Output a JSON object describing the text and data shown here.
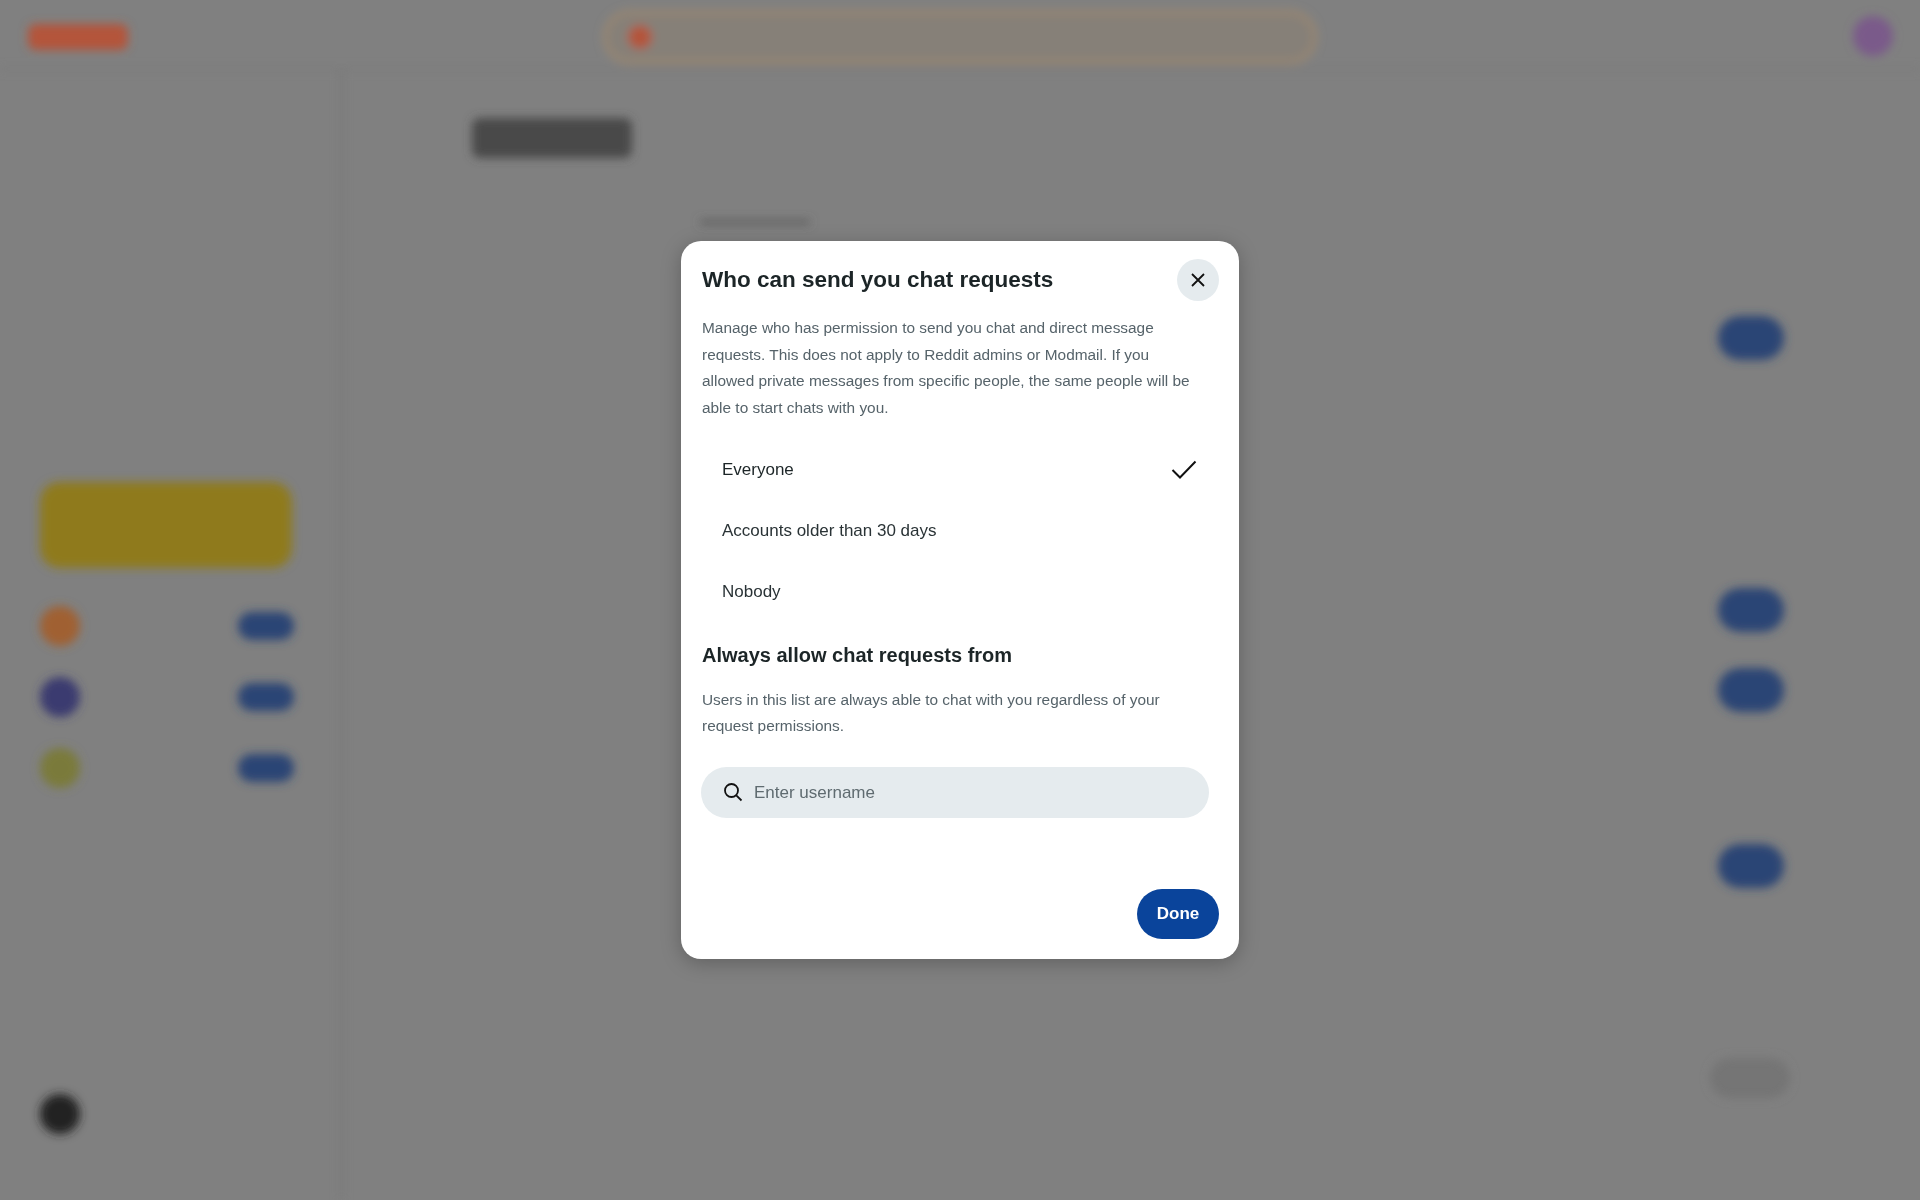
{
  "dialog": {
    "title": "Who can send you chat requests",
    "description": "Manage who has permission to send you chat and direct message requests. This does not apply to Reddit admins or Modmail. If you allowed private messages from specific people, the same people will be able to start chats with you.",
    "options": [
      {
        "label": "Everyone",
        "selected": true
      },
      {
        "label": "Accounts older than 30 days",
        "selected": false
      },
      {
        "label": "Nobody",
        "selected": false
      }
    ],
    "allow_heading": "Always allow chat requests from",
    "allow_description": "Users in this list are always able to chat with you regardless of your request permissions.",
    "search": {
      "placeholder": "Enter username"
    },
    "done_button": "Done"
  }
}
